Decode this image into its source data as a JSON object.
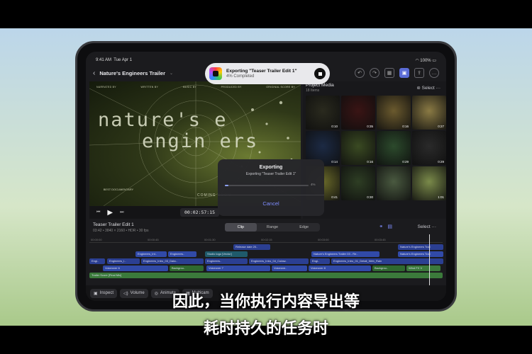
{
  "status_bar": {
    "time": "9:41 AM",
    "date": "Tue Apr 1",
    "battery": "100%"
  },
  "nav": {
    "title": "Nature's Engineers Trailer"
  },
  "export_banner": {
    "title": "Exporting \"Teaser Trailer Edit 1\"",
    "progress_text": "4% Completed"
  },
  "viewer": {
    "credits": [
      "NARRATED BY",
      "WRITTEN BY",
      "MUSIC BY",
      "PRODUCED BY",
      "ORIGINAL SCORE BY"
    ],
    "movie_title_1": "nature's e",
    "movie_title_2": "engin ers",
    "laurel": "BEST DOCUMENTARY",
    "coming": "COMING SOON",
    "timecode": "00:02:57:15"
  },
  "browser": {
    "title": "Project Media",
    "subtitle": "18 Items",
    "select_label": "Select",
    "thumbs": [
      {
        "duration": "0:10",
        "color": "#2a2a1e"
      },
      {
        "duration": "0:35",
        "color": "#3a1414"
      },
      {
        "duration": "0:16",
        "color": "#6b5a2e"
      },
      {
        "duration": "0:27",
        "color": "#8a7a44"
      },
      {
        "duration": "0:14",
        "color": "#1c2a44"
      },
      {
        "duration": "0:16",
        "color": "#3a4a22"
      },
      {
        "duration": "0:29",
        "color": "#2c4a2c"
      },
      {
        "duration": "0:29",
        "color": "#2a2a2a"
      },
      {
        "duration": "0:41",
        "color": "#6a6a2a"
      },
      {
        "duration": "0:30",
        "color": "#2e3e24"
      },
      {
        "duration": "",
        "color": "#4a5a40"
      },
      {
        "duration": "1:01",
        "color": "#7a8a4a"
      }
    ]
  },
  "export_dialog": {
    "title": "Exporting",
    "subtitle": "Exporting \"Teaser Trailer Edit 1\"",
    "progress_pct": 4,
    "progress_label": "4%",
    "cancel_label": "Cancel"
  },
  "timeline": {
    "title": "Teaser Trailer Edit 1",
    "subtitle": "03:42 • 3840 × 2160 • HDR • 30 fps",
    "segments": [
      "Clip",
      "Range",
      "Edge"
    ],
    "select_label": "Select",
    "ruler": [
      "00:00:00",
      "00:00:45",
      "00:01:30",
      "00:02:15",
      "00:03:00",
      "00:03:45"
    ],
    "tracks": {
      "t1": [
        "Release date 20..",
        "Nature's Engineers Trail"
      ],
      "t2": [
        "Engineers_Int..",
        "Engineers..",
        "Studio logo [Vector]",
        "Nature's Engineers Trailer 03 - Re..",
        "Nature's Engineers Trail"
      ],
      "t3": [
        "Engi..",
        "Engineers_I..",
        "Engineers_Intro_03_Data..",
        "Engineers..",
        "Engineers_Intro_04_Cutaw..",
        "Engi..",
        "Engineers_Intro_01_Detail_Web_Rain"
      ],
      "t4": [
        "Voiceover 6",
        "Backgrou..",
        "Voiceover 7",
        "Voiceove..",
        "Voiceover 8",
        "Backgrou..",
        "Wind FX V"
      ],
      "t5": [
        "Trailer Score [Final Mix]"
      ]
    }
  },
  "bottom_bar": {
    "inspect": "Inspect",
    "volume": "Volume",
    "animate": "Animate",
    "multicam": "Multicam"
  },
  "captions": {
    "line1": "因此，当你执行内容导出等",
    "line2": "耗时持久的任务时"
  }
}
